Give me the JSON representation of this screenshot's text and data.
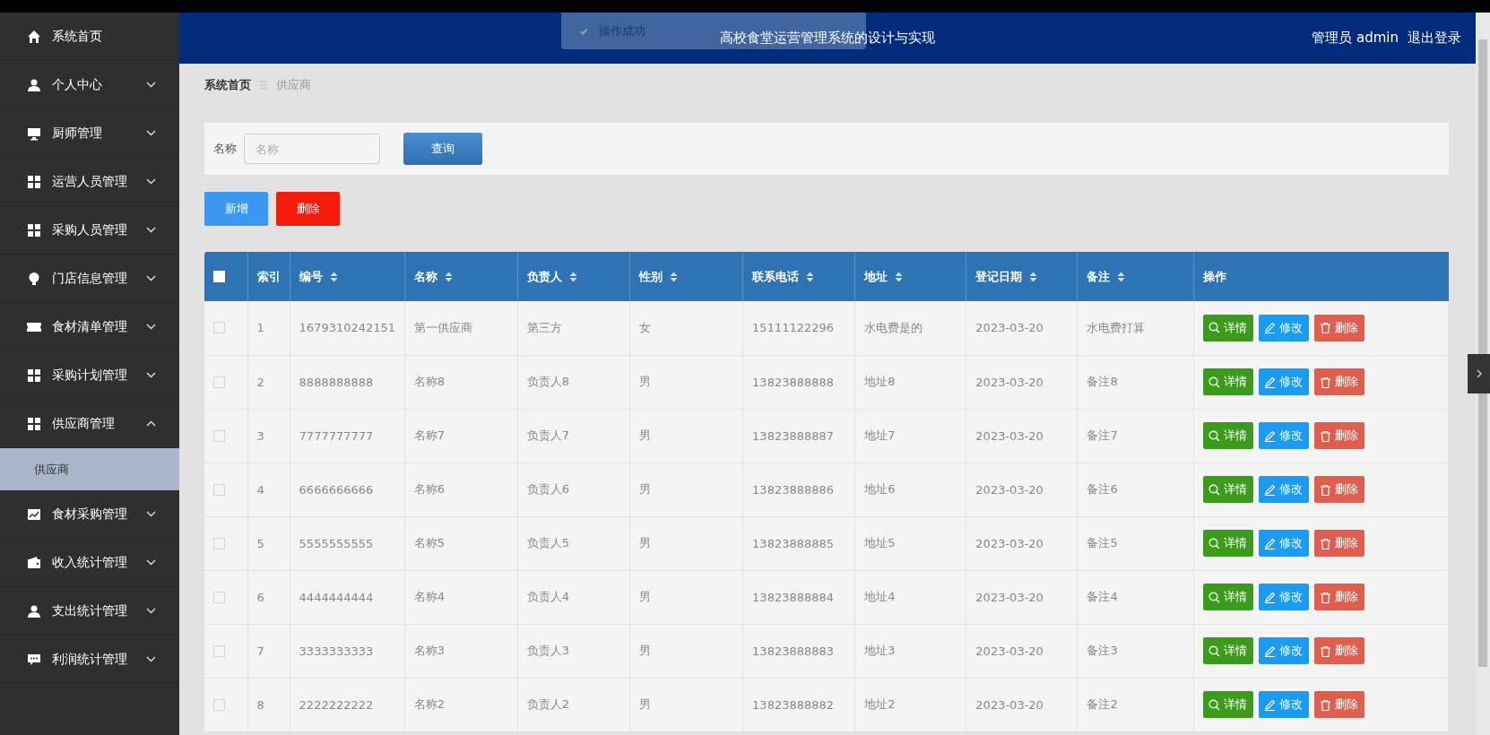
{
  "sidebar": {
    "items": [
      {
        "label": "系统首页",
        "selected": false
      },
      {
        "label": "个人中心",
        "expanded": false,
        "selected": false
      },
      {
        "label": "厨师管理",
        "expanded": false,
        "selected": false
      },
      {
        "label": "运营人员管理",
        "expanded": false,
        "selected": false
      },
      {
        "label": "采购人员管理",
        "expanded": false,
        "selected": false
      },
      {
        "label": "门店信息管理",
        "expanded": false,
        "selected": false
      },
      {
        "label": "食材清单管理",
        "expanded": false,
        "selected": false
      },
      {
        "label": "采购计划管理",
        "expanded": false,
        "selected": false
      },
      {
        "label": "供应商管理",
        "expanded": true,
        "selected": false,
        "children": [
          {
            "label": "供应商",
            "selected": true
          }
        ]
      },
      {
        "label": "食材采购管理",
        "expanded": false,
        "selected": false
      },
      {
        "label": "收入统计管理",
        "expanded": false,
        "selected": false
      },
      {
        "label": "支出统计管理",
        "expanded": false,
        "selected": false
      },
      {
        "label": "利润统计管理",
        "expanded": false,
        "selected": false
      }
    ]
  },
  "header": {
    "title": "高校食堂运营管理系统的设计与实现",
    "user": "管理员 admin",
    "logout": "退出登录"
  },
  "toast": {
    "text": "操作成功"
  },
  "breadcrumb": [
    "系统首页",
    "供应商"
  ],
  "search": {
    "label": "名称",
    "placeholder": "名称",
    "button": "查询"
  },
  "actions": [
    {
      "kind": "add",
      "label": "新增"
    },
    {
      "kind": "delete",
      "label": "删除"
    }
  ],
  "table": {
    "select_all": {
      "checked": false
    },
    "columns": [
      {
        "label": "索引",
        "sortable": false
      },
      {
        "label": "编号",
        "sortable": true
      },
      {
        "label": "名称",
        "sortable": true
      },
      {
        "label": "负责人",
        "sortable": true
      },
      {
        "label": "性别",
        "sortable": true
      },
      {
        "label": "联系电话",
        "sortable": true
      },
      {
        "label": "地址",
        "sortable": true
      },
      {
        "label": "登记日期",
        "sortable": true
      },
      {
        "label": "备注",
        "sortable": true
      },
      {
        "label": "操作",
        "sortable": false
      }
    ],
    "rows": [
      {
        "checked": false,
        "cells": [
          "1",
          "1679310242151",
          "第一供应商",
          "第三方",
          "女",
          "15111122296",
          "水电费是的",
          "2023-03-20",
          "水电费打算"
        ],
        "actions": [
          {
            "kind": "detail",
            "label": "详情"
          },
          {
            "kind": "edit",
            "label": "修改"
          },
          {
            "kind": "delete",
            "label": "删除"
          }
        ]
      },
      {
        "checked": false,
        "cells": [
          "2",
          "8888888888",
          "名称8",
          "负责人8",
          "男",
          "13823888888",
          "地址8",
          "2023-03-20",
          "备注8"
        ],
        "actions": [
          {
            "kind": "detail",
            "label": "详情"
          },
          {
            "kind": "edit",
            "label": "修改"
          },
          {
            "kind": "delete",
            "label": "删除"
          }
        ]
      },
      {
        "checked": false,
        "cells": [
          "3",
          "7777777777",
          "名称7",
          "负责人7",
          "男",
          "13823888887",
          "地址7",
          "2023-03-20",
          "备注7"
        ],
        "actions": [
          {
            "kind": "detail",
            "label": "详情"
          },
          {
            "kind": "edit",
            "label": "修改"
          },
          {
            "kind": "delete",
            "label": "删除"
          }
        ]
      },
      {
        "checked": false,
        "cells": [
          "4",
          "6666666666",
          "名称6",
          "负责人6",
          "男",
          "13823888886",
          "地址6",
          "2023-03-20",
          "备注6"
        ],
        "actions": [
          {
            "kind": "detail",
            "label": "详情"
          },
          {
            "kind": "edit",
            "label": "修改"
          },
          {
            "kind": "delete",
            "label": "删除"
          }
        ]
      },
      {
        "checked": false,
        "cells": [
          "5",
          "5555555555",
          "名称5",
          "负责人5",
          "男",
          "13823888885",
          "地址5",
          "2023-03-20",
          "备注5"
        ],
        "actions": [
          {
            "kind": "detail",
            "label": "详情"
          },
          {
            "kind": "edit",
            "label": "修改"
          },
          {
            "kind": "delete",
            "label": "删除"
          }
        ]
      },
      {
        "checked": false,
        "cells": [
          "6",
          "4444444444",
          "名称4",
          "负责人4",
          "男",
          "13823888884",
          "地址4",
          "2023-03-20",
          "备注4"
        ],
        "actions": [
          {
            "kind": "detail",
            "label": "详情"
          },
          {
            "kind": "edit",
            "label": "修改"
          },
          {
            "kind": "delete",
            "label": "删除"
          }
        ]
      },
      {
        "checked": false,
        "cells": [
          "7",
          "3333333333",
          "名称3",
          "负责人3",
          "男",
          "13823888883",
          "地址3",
          "2023-03-20",
          "备注3"
        ],
        "actions": [
          {
            "kind": "detail",
            "label": "详情"
          },
          {
            "kind": "edit",
            "label": "修改"
          },
          {
            "kind": "delete",
            "label": "删除"
          }
        ]
      },
      {
        "checked": false,
        "cells": [
          "8",
          "2222222222",
          "名称2",
          "负责人2",
          "男",
          "13823888882",
          "地址2",
          "2023-03-20",
          "备注2"
        ],
        "actions": [
          {
            "kind": "detail",
            "label": "详情"
          },
          {
            "kind": "edit",
            "label": "修改"
          },
          {
            "kind": "delete",
            "label": "删除"
          }
        ]
      }
    ]
  }
}
